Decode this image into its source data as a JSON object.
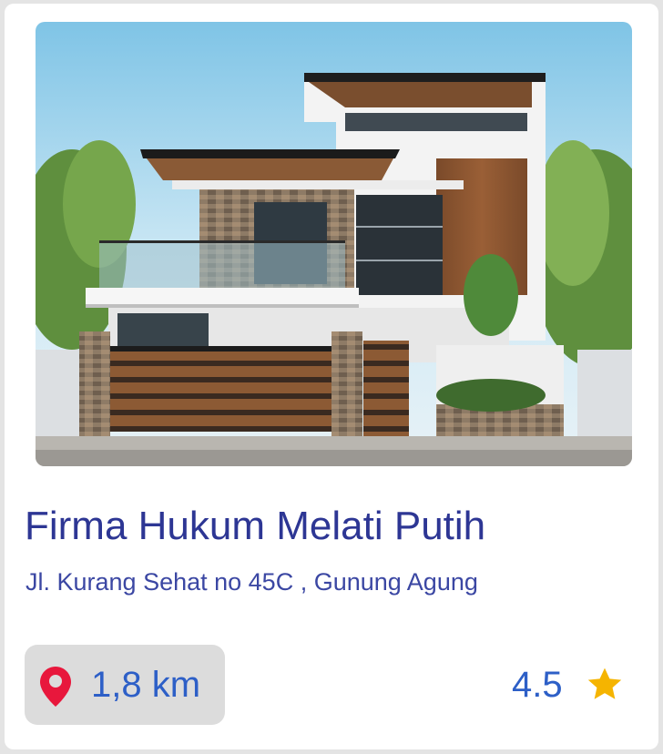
{
  "place": {
    "name": "Firma Hukum Melati Putih",
    "address": "Jl. Kurang Sehat no 45C , Gunung Agung",
    "distance": "1,8 km",
    "rating": "4.5"
  },
  "icons": {
    "location": "location-pin-icon",
    "rating": "star-icon"
  },
  "colors": {
    "title": "#2d3694",
    "address": "#3b47a3",
    "value_text": "#2d5fc7",
    "pin": "#e8173c",
    "star": "#f5b400",
    "chip_bg": "#dcdcdc"
  }
}
